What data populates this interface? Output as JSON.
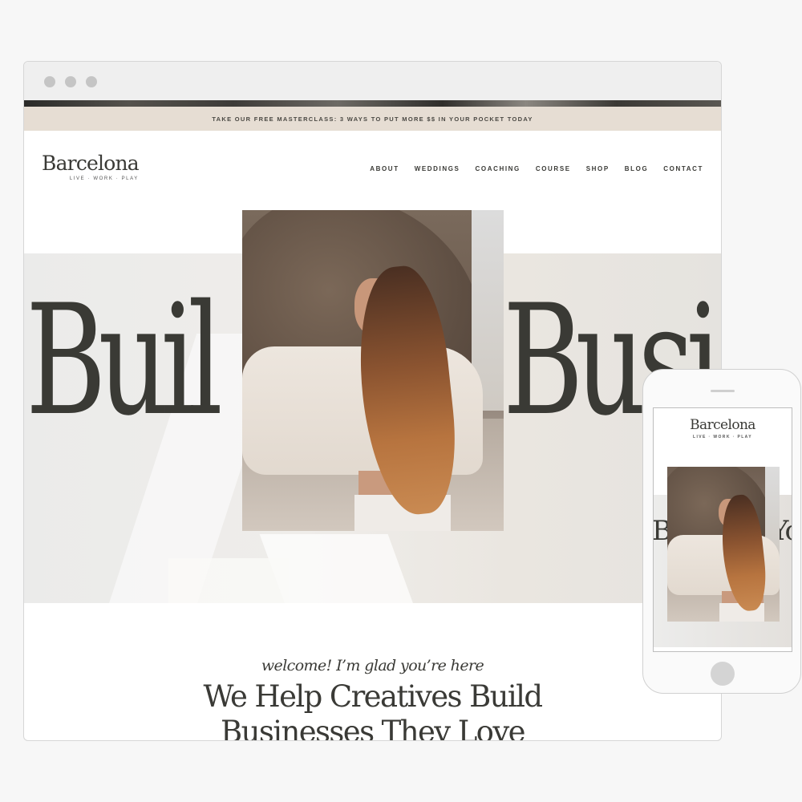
{
  "browser": {
    "window_controls": [
      "close",
      "minimize",
      "maximize"
    ]
  },
  "announcement": {
    "text": "TAKE OUR FREE MASTERCLASS: 3 WAYS TO PUT MORE $$ IN YOUR POCKET TODAY"
  },
  "header": {
    "logo_title": "Barcelona",
    "logo_tagline": "LIVE · WORK · PLAY",
    "nav": [
      {
        "label": "ABOUT"
      },
      {
        "label": "WEDDINGS"
      },
      {
        "label": "COACHING"
      },
      {
        "label": "COURSE"
      },
      {
        "label": "SHOP"
      },
      {
        "label": "BLOG"
      },
      {
        "label": "CONTACT"
      }
    ]
  },
  "hero": {
    "word_left": "Buil",
    "word_right": "Busi",
    "photo_alt": "woman-on-beach-photo"
  },
  "intro": {
    "welcome": "welcome! I’m glad you’re here",
    "headline_line1": "We Help Creatives Build",
    "headline_line2": "Businesses They Love"
  },
  "mobile": {
    "logo_title": "Barcelona",
    "logo_tagline": "LIVE · WORK · PLAY",
    "word_left": "B",
    "word_right": "Yo"
  },
  "colors": {
    "announcement_bg": "#e6ddd3",
    "text_dark": "#3a3a36",
    "page_bg": "#f7f7f7"
  }
}
